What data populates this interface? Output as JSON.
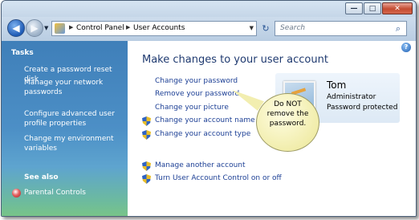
{
  "window": {
    "controls": {
      "minimize": "—",
      "maximize": "□",
      "close": "✕"
    }
  },
  "nav": {
    "back": "◀",
    "forward": "▶",
    "breadcrumb": [
      "Control Panel",
      "User Accounts"
    ],
    "search_placeholder": "Search"
  },
  "sidebar": {
    "heading": "Tasks",
    "tasks": [
      "Create a password reset disk",
      "Manage your network passwords",
      "Configure advanced user profile properties",
      "Change my environment variables"
    ],
    "see_also_heading": "See also",
    "see_also": [
      "Parental Controls"
    ]
  },
  "main": {
    "title": "Make changes to your user account",
    "tasks": [
      "Change your password",
      "Remove your password",
      "Change your picture",
      "Change your account name",
      "Change your account type"
    ],
    "other_tasks": [
      "Manage another account",
      "Turn User Account Control on or off"
    ]
  },
  "user": {
    "name": "Tom",
    "role": "Administrator",
    "status": "Password protected"
  },
  "callout": {
    "lines": [
      "Do NOT",
      "remove the",
      "password."
    ]
  },
  "colors": {
    "link": "#1c3f95",
    "title": "#1f3a70",
    "sidebar_top": "#3f7fb9",
    "sidebar_bottom": "#78c488",
    "callout_fill": "#f0eca8"
  }
}
